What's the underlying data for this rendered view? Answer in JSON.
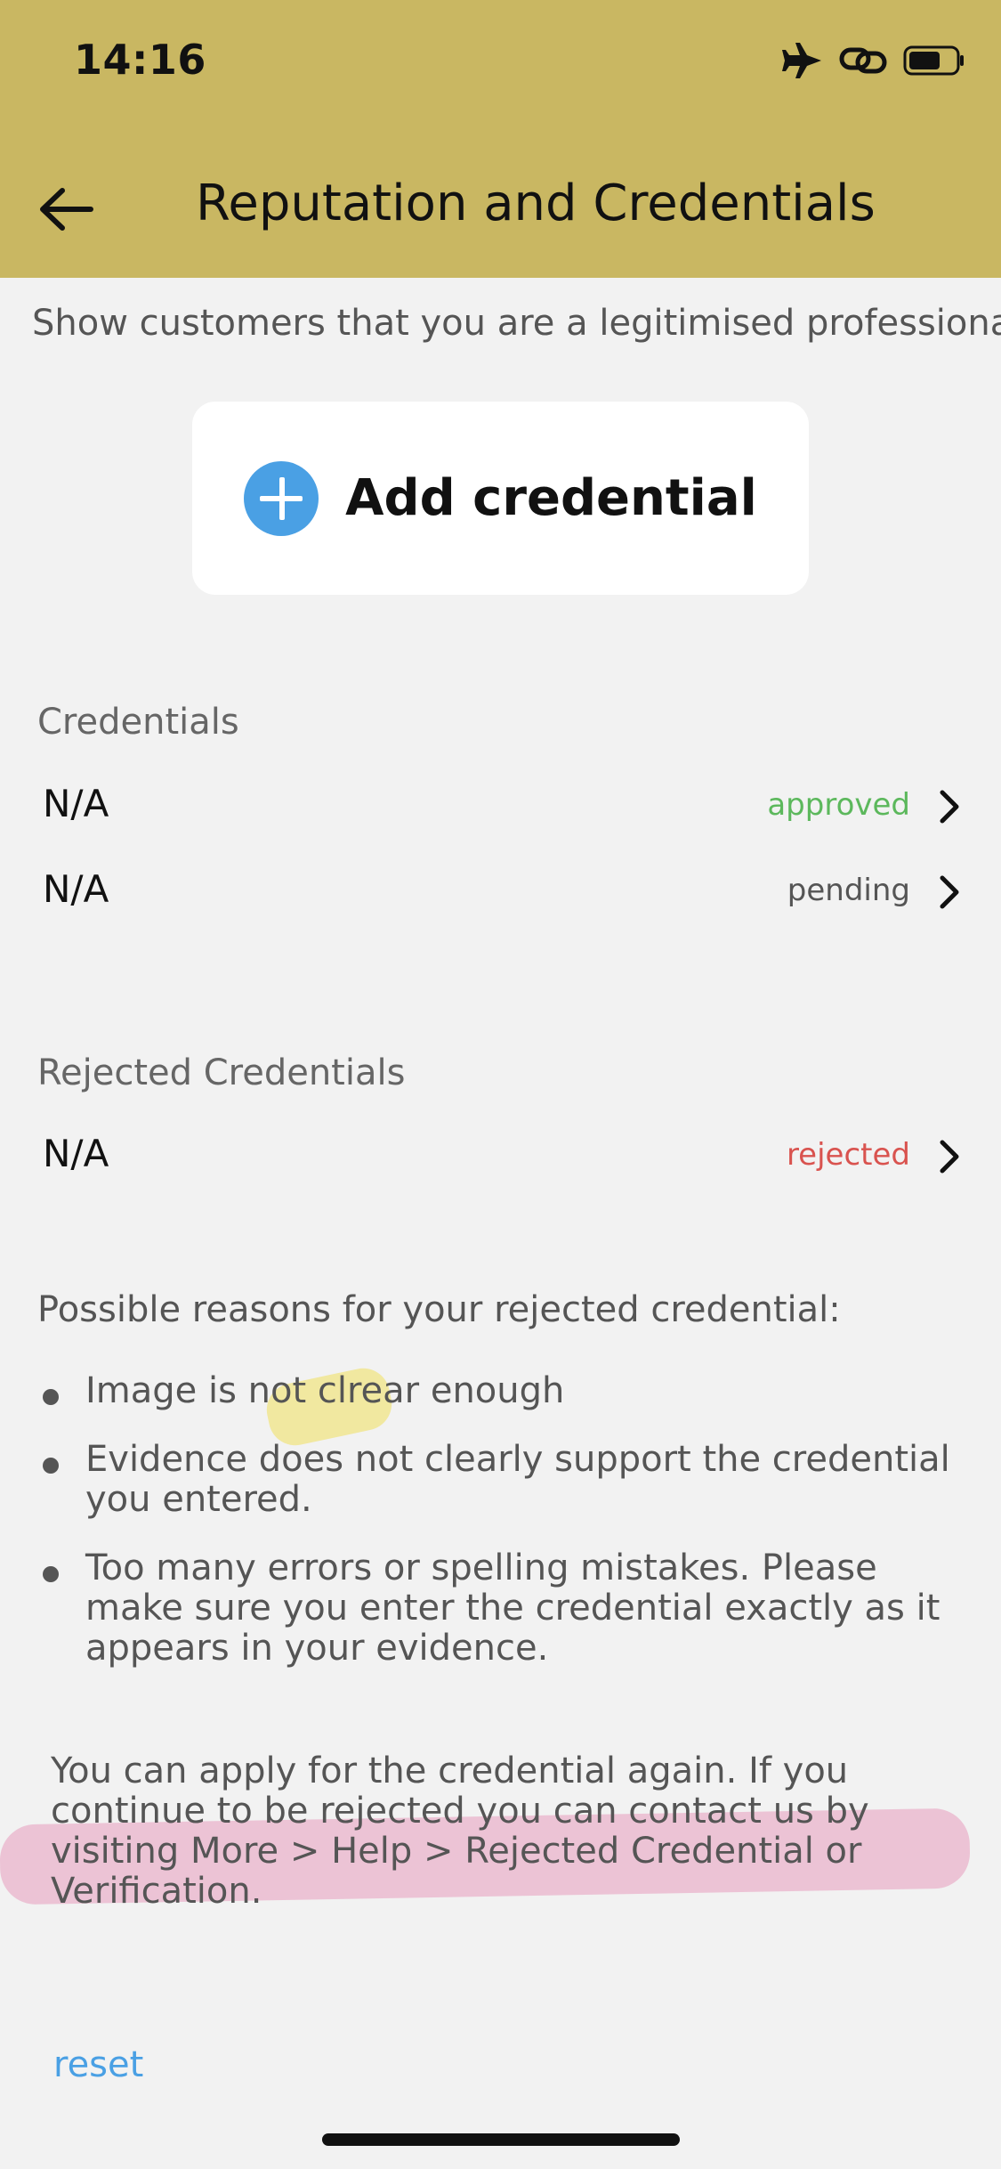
{
  "status_bar": {
    "time": "14:16"
  },
  "header": {
    "title": "Reputation and Credentials"
  },
  "subtitle": "Show customers that you are a legitimised professional!",
  "add_card": {
    "label": "Add credential"
  },
  "credentials": {
    "header": "Credentials",
    "items": [
      {
        "title": "N/A",
        "status": "approved"
      },
      {
        "title": "N/A",
        "status": "pending"
      }
    ]
  },
  "rejected": {
    "header": "Rejected Credentials",
    "items": [
      {
        "title": "N/A",
        "status": "rejected"
      }
    ]
  },
  "reasons": {
    "title": "Possible reasons for your rejected credential:",
    "items": [
      "Image is not clrear enough",
      "Evidence does not clearly support the credential you entered.",
      "Too many errors or spelling mistakes. Please make sure you enter the credential exactly as it appears in your evidence."
    ]
  },
  "info": "You can apply for the credential again. If you continue to be rejected you can contact us by visiting More > Help > Rejected Credential or Verification.",
  "reset": "reset",
  "colors": {
    "header_bg": "#c9b762",
    "approved": "#5cb85c",
    "pending": "#555555",
    "rejected": "#d9534f",
    "accent": "#4aa0e4"
  },
  "icons": {
    "back": "arrow-left-icon",
    "add": "plus-circle-icon",
    "chevron": "chevron-right-icon",
    "airplane": "airplane-icon",
    "link": "link-icon",
    "battery": "battery-icon"
  }
}
